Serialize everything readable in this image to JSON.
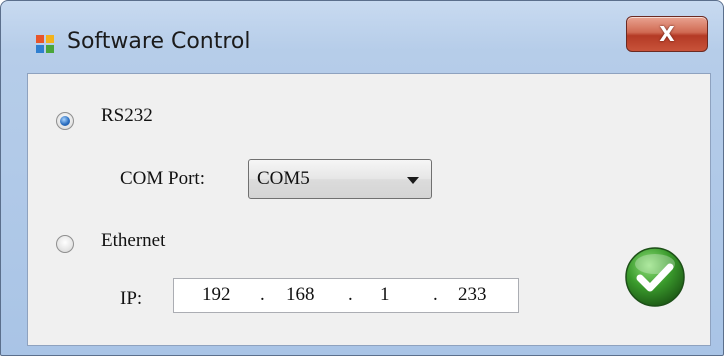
{
  "window": {
    "title": "Software Control",
    "close_label": "X"
  },
  "rs232": {
    "label": "RS232",
    "selected": true
  },
  "com_port": {
    "label": "COM Port:",
    "value": "COM5"
  },
  "ethernet": {
    "label": "Ethernet",
    "selected": false
  },
  "ip": {
    "label": "IP:",
    "octets": [
      "192",
      "168",
      "1",
      "233"
    ],
    "separator": "."
  },
  "icons": {
    "app": "app-window-icon",
    "ok": "checkmark-icon"
  },
  "colors": {
    "ok_green": "#3a9a2c",
    "close_red": "#c8533a"
  }
}
